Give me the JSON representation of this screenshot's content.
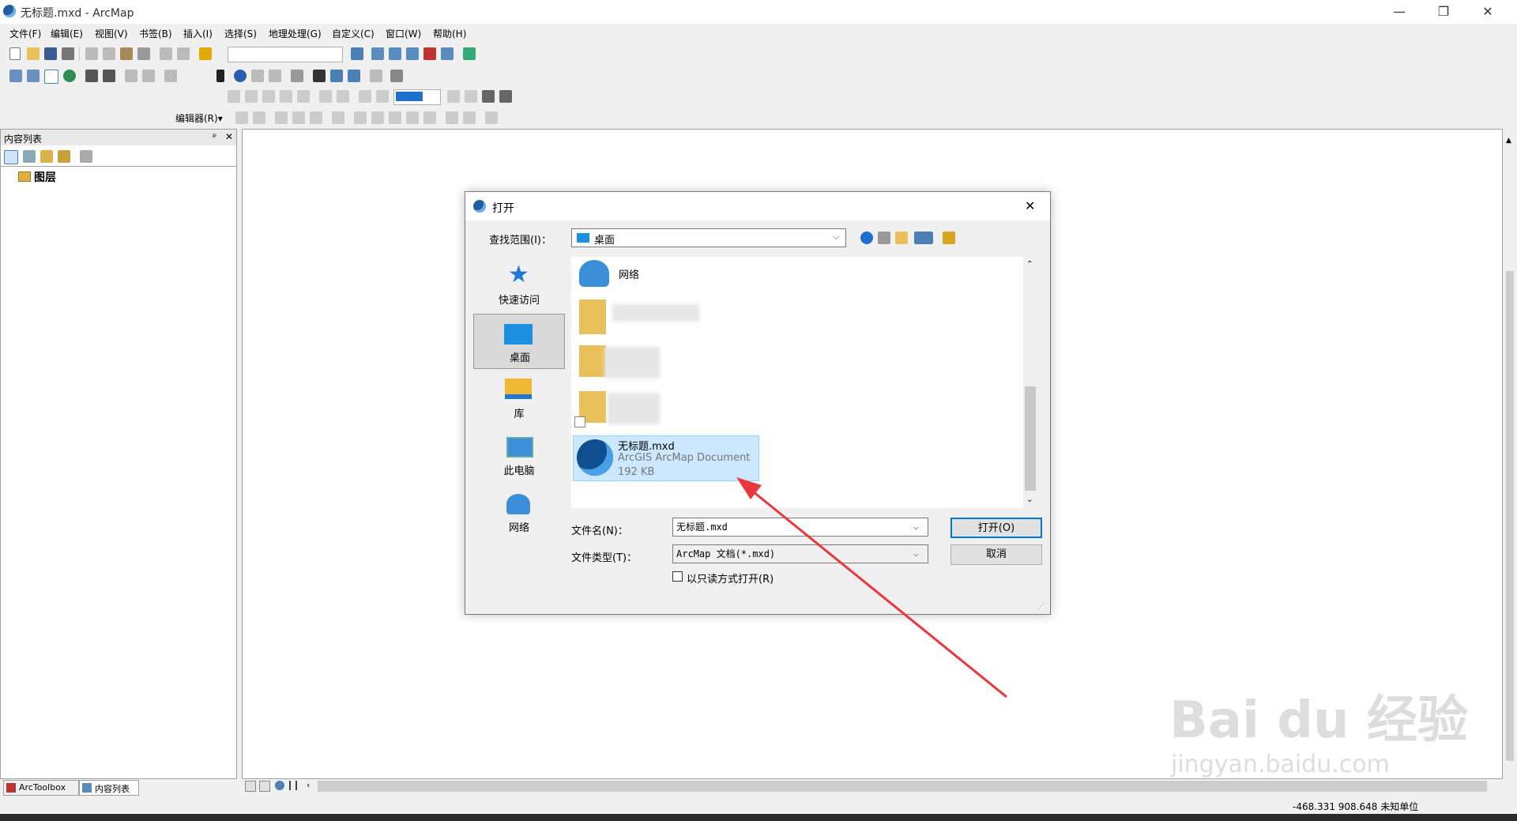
{
  "window": {
    "title": "无标题.mxd - ArcMap",
    "minimize": "—",
    "maximize": "❐",
    "close": "✕"
  },
  "menu": [
    "文件(F)",
    "编辑(E)",
    "视图(V)",
    "书签(B)",
    "插入(I)",
    "选择(S)",
    "地理处理(G)",
    "自定义(C)",
    "窗口(W)",
    "帮助(H)"
  ],
  "editor_toolbar": {
    "label": "编辑器(R)▾"
  },
  "toc": {
    "title": "内容列表",
    "root_layer": "图层",
    "pin": "ᵖ",
    "close": "✕"
  },
  "bottom_tabs": [
    "ArcToolbox",
    "内容列表"
  ],
  "status": {
    "coords": "-468.331  908.648 未知单位"
  },
  "dialog": {
    "title": "打开",
    "close": "✕",
    "look_in_label": "查找范围(I)：",
    "look_in_value": "桌面",
    "places": [
      {
        "label": "快速访问"
      },
      {
        "label": "桌面"
      },
      {
        "label": "库"
      },
      {
        "label": "此电脑"
      },
      {
        "label": "网络"
      }
    ],
    "files": {
      "network": "网络",
      "selected_name": "无标题.mxd",
      "selected_type": "ArcGIS ArcMap Document",
      "selected_size": "192 KB"
    },
    "filename_label": "文件名(N)：",
    "filename_value": "无标题.mxd",
    "filetype_label": "文件类型(T)：",
    "filetype_value": "ArcMap 文档(*.mxd)",
    "readonly_label": "以只读方式打开(R)",
    "open_button": "打开(O)",
    "cancel_button": "取消"
  },
  "watermark": {
    "brand": "Bai du 经验",
    "url": "jingyan.baidu.com"
  },
  "colors": {
    "accent": "#0078d7",
    "selection": "#cce8ff",
    "arrow": "#e8373d"
  }
}
